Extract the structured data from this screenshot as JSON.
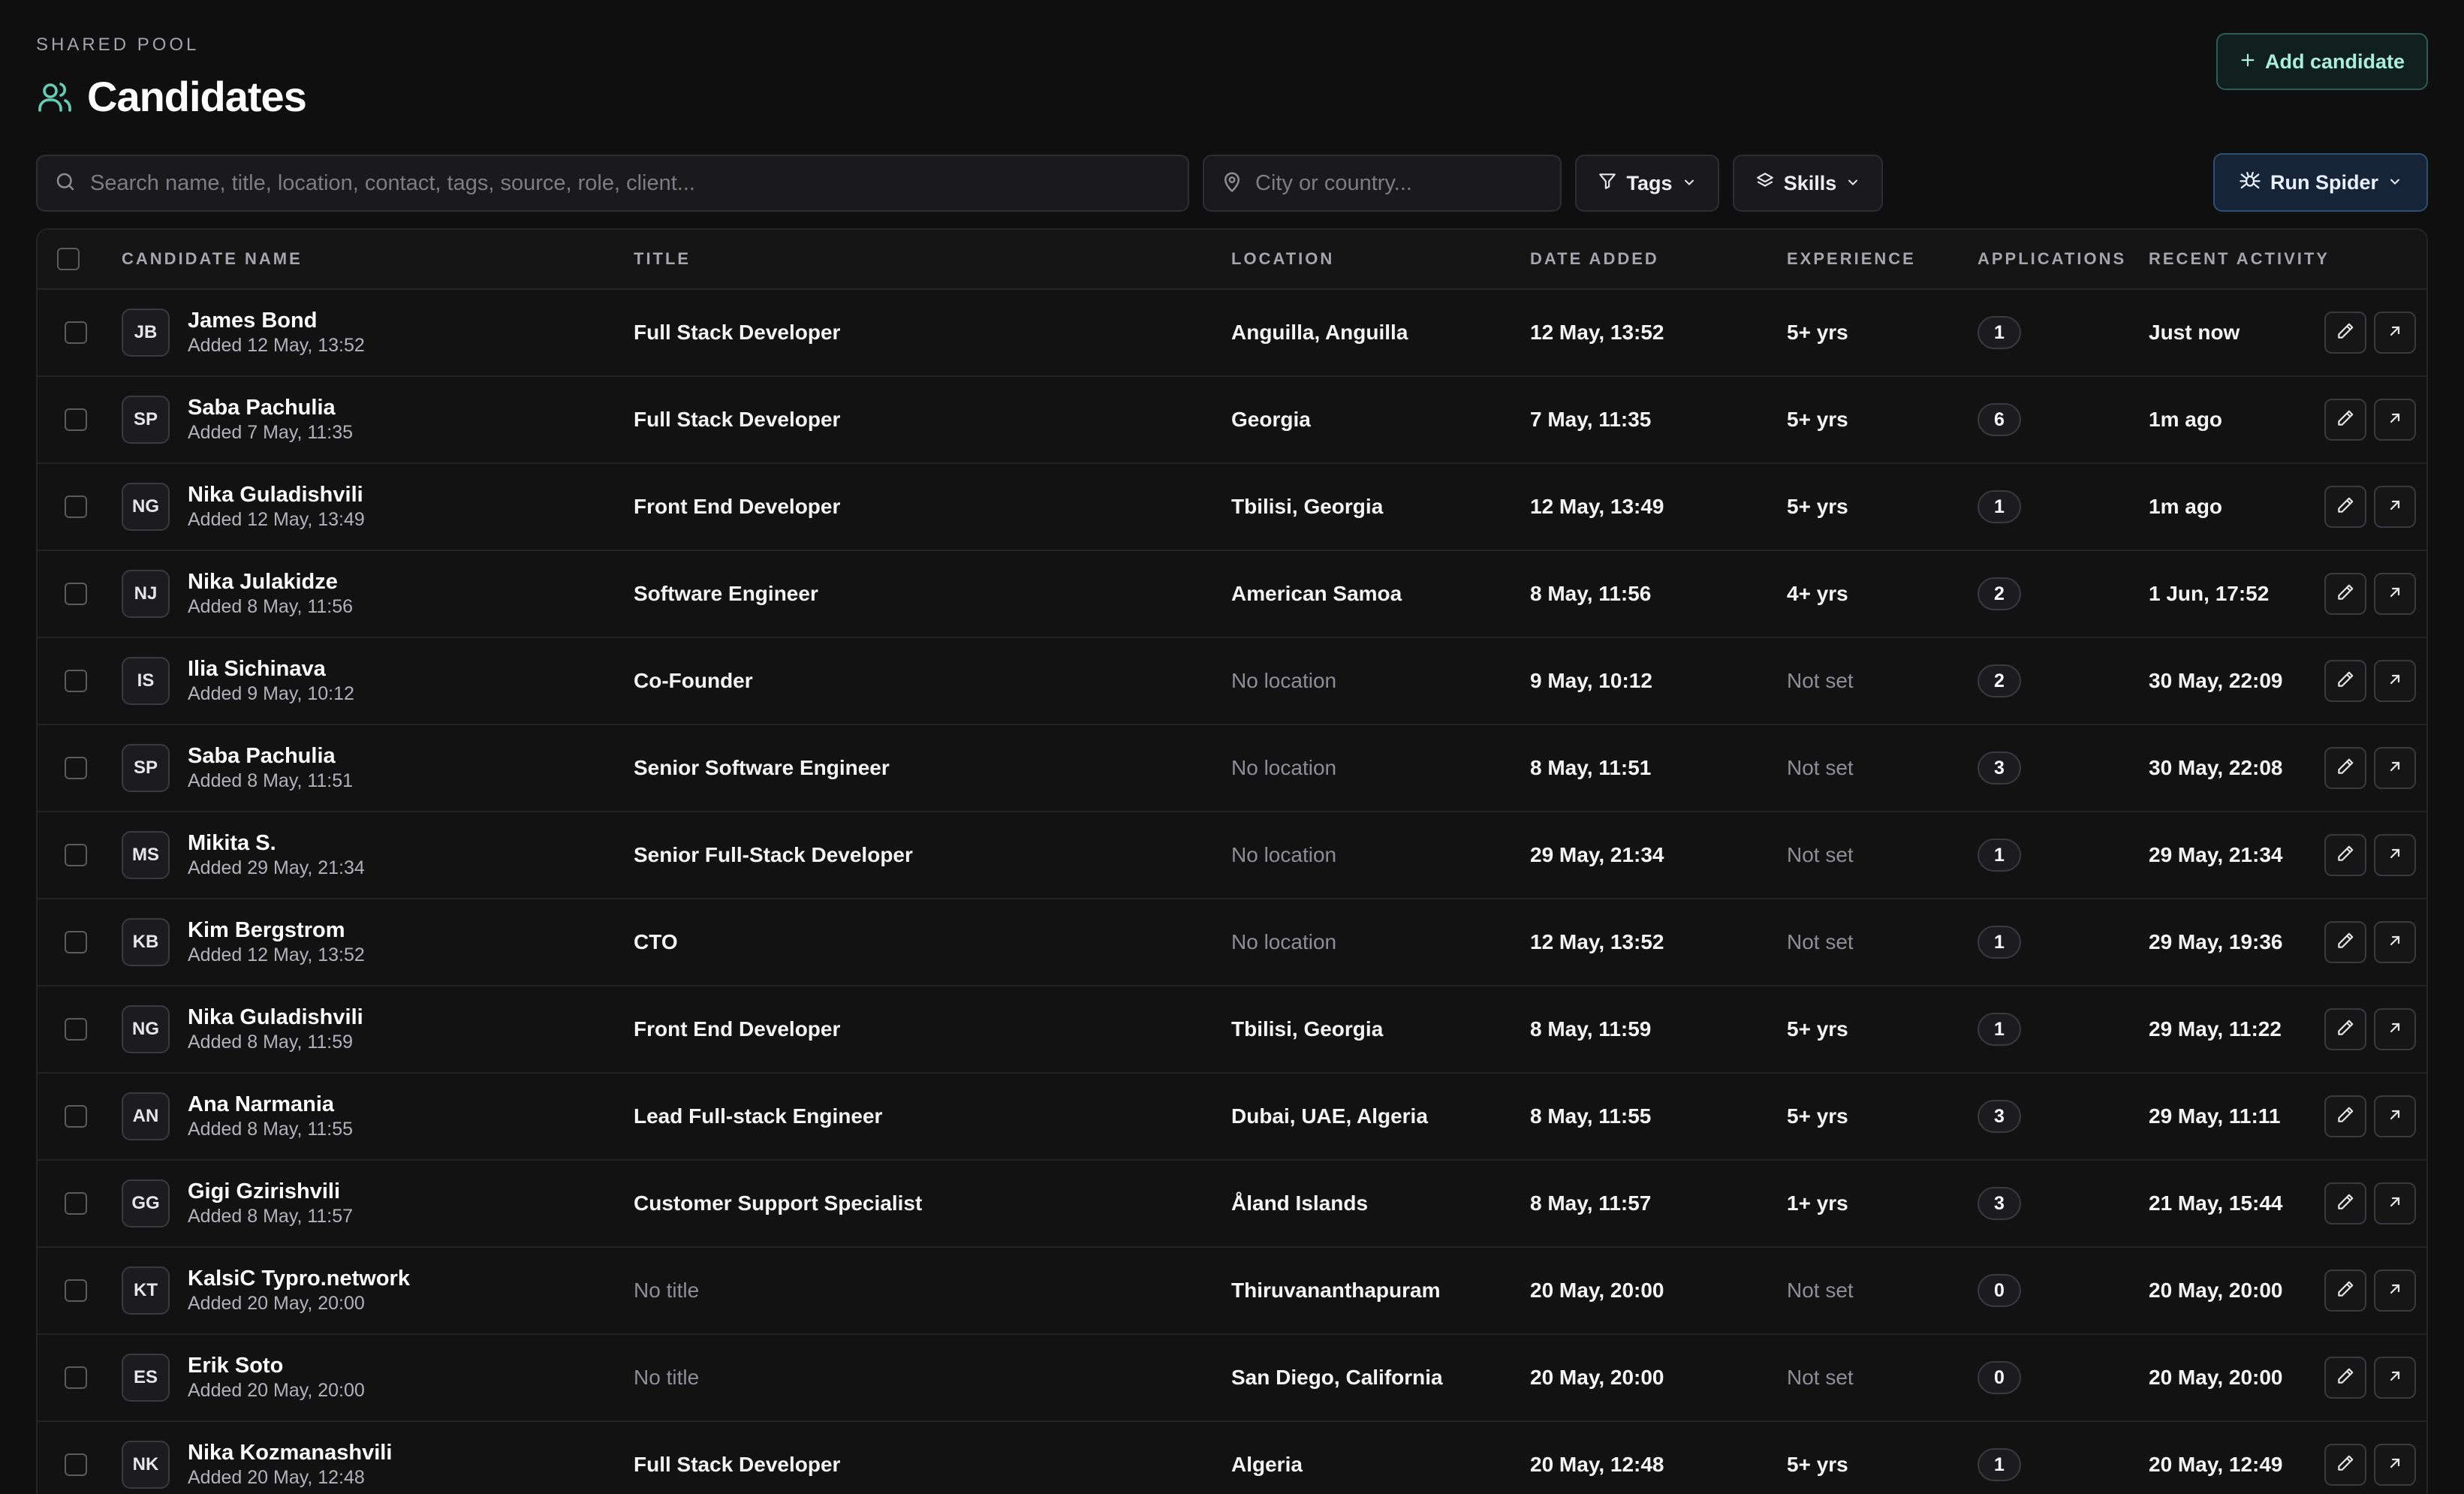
{
  "header": {
    "eyebrow": "SHARED POOL",
    "title": "Candidates",
    "add_button": "Add candidate",
    "run_button": "Run Spider"
  },
  "filters": {
    "search_placeholder": "Search name, title, location, contact, tags, source, role, client...",
    "city_placeholder": "City or country...",
    "tags_label": "Tags",
    "skills_label": "Skills"
  },
  "table": {
    "columns": {
      "name": "CANDIDATE NAME",
      "title": "TITLE",
      "location": "LOCATION",
      "date": "DATE ADDED",
      "experience": "EXPERIENCE",
      "applications": "APPLICATIONS",
      "activity": "RECENT ACTIVITY"
    },
    "rows": [
      {
        "initials": "JB",
        "name": "James Bond",
        "added": "Added 12 May, 13:52",
        "title": "Full Stack Developer",
        "title_muted": false,
        "location": "Anguilla, Anguilla",
        "location_muted": false,
        "date": "12 May, 13:52",
        "experience": "5+ yrs",
        "experience_muted": false,
        "applications": "1",
        "activity": "Just now"
      },
      {
        "initials": "SP",
        "name": "Saba Pachulia",
        "added": "Added 7 May, 11:35",
        "title": "Full Stack Developer",
        "title_muted": false,
        "location": "Georgia",
        "location_muted": false,
        "date": "7 May, 11:35",
        "experience": "5+ yrs",
        "experience_muted": false,
        "applications": "6",
        "activity": "1m ago"
      },
      {
        "initials": "NG",
        "name": "Nika Guladishvili",
        "added": "Added 12 May, 13:49",
        "title": "Front End Developer",
        "title_muted": false,
        "location": "Tbilisi, Georgia",
        "location_muted": false,
        "date": "12 May, 13:49",
        "experience": "5+ yrs",
        "experience_muted": false,
        "applications": "1",
        "activity": "1m ago"
      },
      {
        "initials": "NJ",
        "name": "Nika Julakidze",
        "added": "Added 8 May, 11:56",
        "title": "Software Engineer",
        "title_muted": false,
        "location": "American Samoa",
        "location_muted": false,
        "date": "8 May, 11:56",
        "experience": "4+ yrs",
        "experience_muted": false,
        "applications": "2",
        "activity": "1 Jun, 17:52"
      },
      {
        "initials": "IS",
        "name": "Ilia Sichinava",
        "added": "Added 9 May, 10:12",
        "title": "Co-Founder",
        "title_muted": false,
        "location": "No location",
        "location_muted": true,
        "date": "9 May, 10:12",
        "experience": "Not set",
        "experience_muted": true,
        "applications": "2",
        "activity": "30 May, 22:09"
      },
      {
        "initials": "SP",
        "name": "Saba Pachulia",
        "added": "Added 8 May, 11:51",
        "title": "Senior Software Engineer",
        "title_muted": false,
        "location": "No location",
        "location_muted": true,
        "date": "8 May, 11:51",
        "experience": "Not set",
        "experience_muted": true,
        "applications": "3",
        "activity": "30 May, 22:08"
      },
      {
        "initials": "MS",
        "name": "Mikita S.",
        "added": "Added 29 May, 21:34",
        "title": "Senior Full-Stack Developer",
        "title_muted": false,
        "location": "No location",
        "location_muted": true,
        "date": "29 May, 21:34",
        "experience": "Not set",
        "experience_muted": true,
        "applications": "1",
        "activity": "29 May, 21:34"
      },
      {
        "initials": "KB",
        "name": "Kim Bergstrom",
        "added": "Added 12 May, 13:52",
        "title": "CTO",
        "title_muted": false,
        "location": "No location",
        "location_muted": true,
        "date": "12 May, 13:52",
        "experience": "Not set",
        "experience_muted": true,
        "applications": "1",
        "activity": "29 May, 19:36"
      },
      {
        "initials": "NG",
        "name": "Nika Guladishvili",
        "added": "Added 8 May, 11:59",
        "title": "Front End Developer",
        "title_muted": false,
        "location": "Tbilisi, Georgia",
        "location_muted": false,
        "date": "8 May, 11:59",
        "experience": "5+ yrs",
        "experience_muted": false,
        "applications": "1",
        "activity": "29 May, 11:22"
      },
      {
        "initials": "AN",
        "name": "Ana Narmania",
        "added": "Added 8 May, 11:55",
        "title": "Lead Full-stack Engineer",
        "title_muted": false,
        "location": "Dubai, UAE, Algeria",
        "location_muted": false,
        "date": "8 May, 11:55",
        "experience": "5+ yrs",
        "experience_muted": false,
        "applications": "3",
        "activity": "29 May, 11:11"
      },
      {
        "initials": "GG",
        "name": "Gigi Gzirishvili",
        "added": "Added 8 May, 11:57",
        "title": "Customer Support Specialist",
        "title_muted": false,
        "location": "Åland Islands",
        "location_muted": false,
        "date": "8 May, 11:57",
        "experience": "1+ yrs",
        "experience_muted": false,
        "applications": "3",
        "activity": "21 May, 15:44"
      },
      {
        "initials": "KT",
        "name": "KalsiC Typro.network",
        "added": "Added 20 May, 20:00",
        "title": "No title",
        "title_muted": true,
        "location": "Thiruvananthapuram",
        "location_muted": false,
        "date": "20 May, 20:00",
        "experience": "Not set",
        "experience_muted": true,
        "applications": "0",
        "activity": "20 May, 20:00"
      },
      {
        "initials": "ES",
        "name": "Erik Soto",
        "added": "Added 20 May, 20:00",
        "title": "No title",
        "title_muted": true,
        "location": "San Diego, California",
        "location_muted": false,
        "date": "20 May, 20:00",
        "experience": "Not set",
        "experience_muted": true,
        "applications": "0",
        "activity": "20 May, 20:00"
      },
      {
        "initials": "NK",
        "name": "Nika Kozmanashvili",
        "added": "Added 20 May, 12:48",
        "title": "Full Stack Developer",
        "title_muted": false,
        "location": "Algeria",
        "location_muted": false,
        "date": "20 May, 12:48",
        "experience": "5+ yrs",
        "experience_muted": false,
        "applications": "1",
        "activity": "20 May, 12:49"
      }
    ]
  },
  "colors": {
    "background": "#0f0f10",
    "accent_teal": "#a8f0dc",
    "accent_blue": "#2f4f72"
  }
}
